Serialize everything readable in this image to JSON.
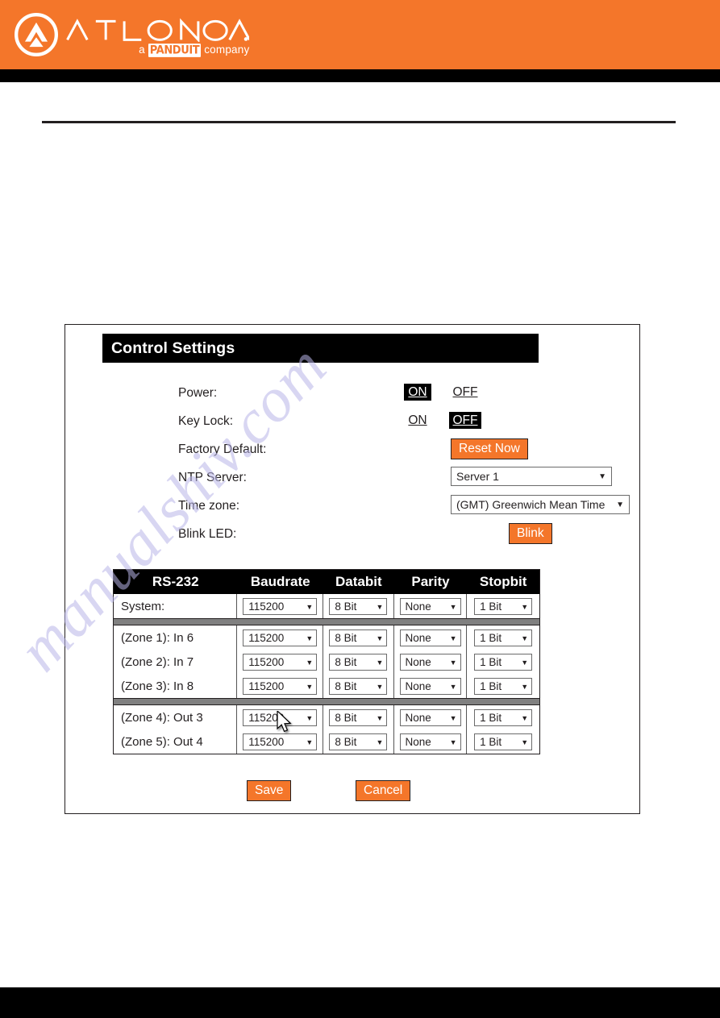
{
  "header": {
    "brand_name": "ATLONA",
    "tagline_prefix": "a",
    "tagline_brand": "PANDUIT",
    "tagline_suffix": "company",
    "logo_icon": "atlona-circle-chevron-logo",
    "brand_color": "#F4762A",
    "bar_color": "#000000"
  },
  "watermark": {
    "text": "manualshiv.com",
    "color": "#b9b5e8"
  },
  "panel": {
    "title": "Control Settings",
    "settings": [
      {
        "label": "Power:",
        "control": "onoff",
        "options": [
          "ON",
          "OFF"
        ],
        "selected": "ON"
      },
      {
        "label": "Key Lock:",
        "control": "onoff",
        "options": [
          "ON",
          "OFF"
        ],
        "selected": "OFF"
      },
      {
        "label": "Factory Default:",
        "control": "button",
        "button_label": "Reset Now"
      },
      {
        "label": "NTP Server:",
        "control": "select",
        "value": "Server 1"
      },
      {
        "label": "Time zone:",
        "control": "select",
        "value": "(GMT) Greenwich Mean Time"
      },
      {
        "label": "Blink LED:",
        "control": "button",
        "button_label": "Blink"
      }
    ],
    "rs232_table": {
      "columns": [
        "RS-232",
        "Baudrate",
        "Databit",
        "Parity",
        "Stopbit"
      ],
      "rows": [
        {
          "name": "System:",
          "baudrate": "115200",
          "databit": "8 Bit",
          "parity": "None",
          "stopbit": "1 Bit"
        },
        {
          "name": "(Zone 1): In 6",
          "baudrate": "115200",
          "databit": "8 Bit",
          "parity": "None",
          "stopbit": "1 Bit"
        },
        {
          "name": "(Zone 2): In 7",
          "baudrate": "115200",
          "databit": "8 Bit",
          "parity": "None",
          "stopbit": "1 Bit"
        },
        {
          "name": "(Zone 3): In 8",
          "baudrate": "115200",
          "databit": "8 Bit",
          "parity": "None",
          "stopbit": "1 Bit"
        },
        {
          "name": "(Zone 4): Out 3",
          "baudrate": "115200",
          "databit": "8 Bit",
          "parity": "None",
          "stopbit": "1 Bit"
        },
        {
          "name": "(Zone 5): Out 4",
          "baudrate": "115200",
          "databit": "8 Bit",
          "parity": "None",
          "stopbit": "1 Bit"
        }
      ],
      "group_breaks_after": [
        0,
        3
      ]
    },
    "actions": {
      "save_label": "Save",
      "cancel_label": "Cancel"
    },
    "caret_glyph": "▼"
  },
  "cursor": {
    "icon": "mouse-pointer-arrow",
    "over": "zone4-baudrate-select"
  }
}
